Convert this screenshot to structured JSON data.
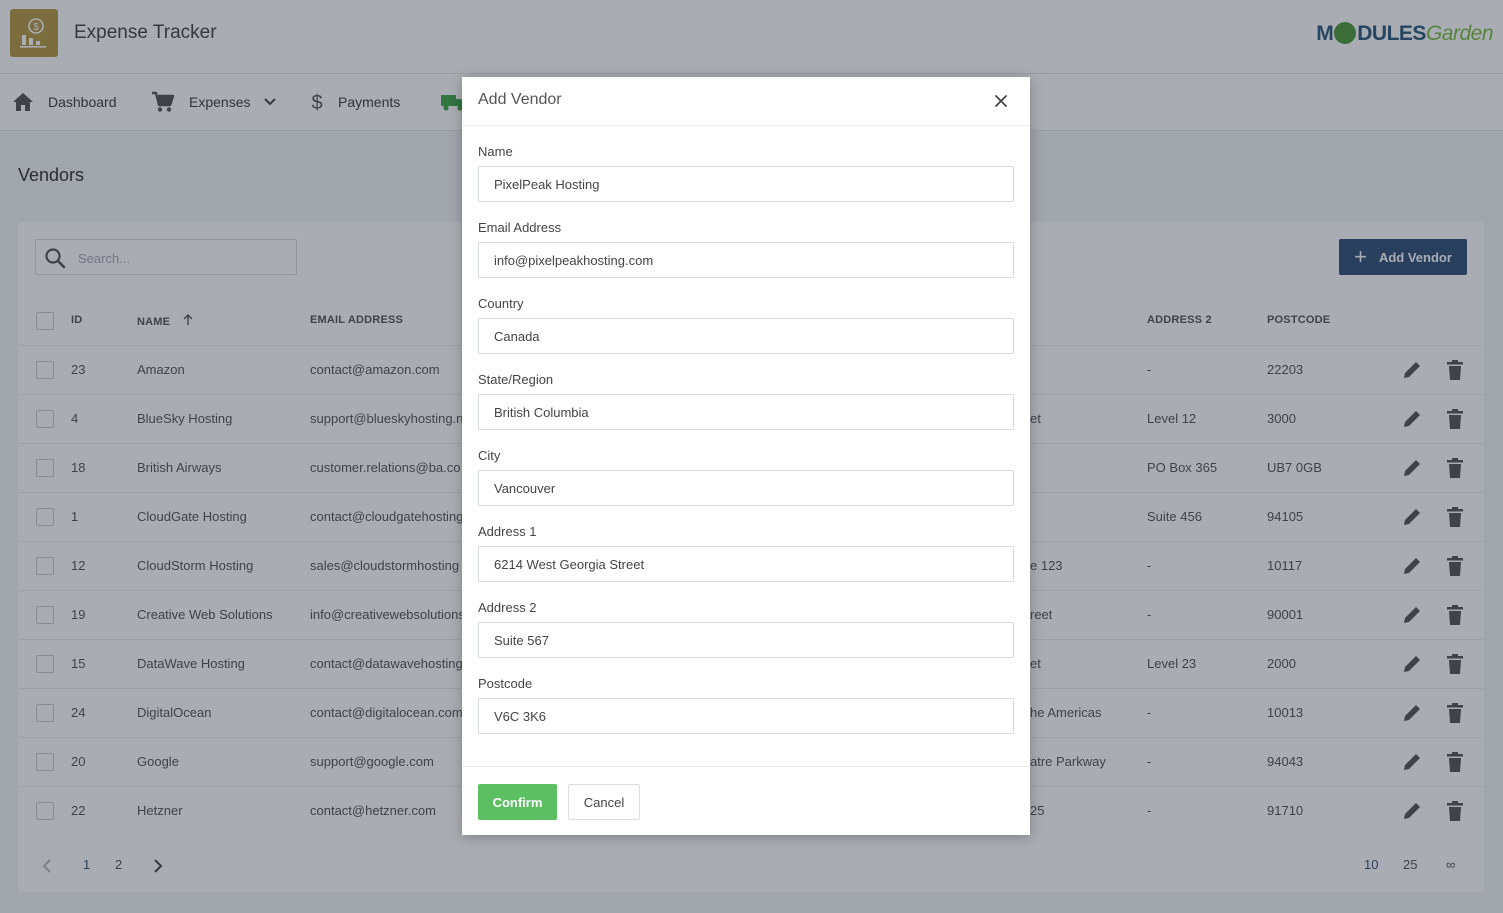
{
  "app": {
    "title": "Expense Tracker",
    "brand_main": "M",
    "brand_rest": "DULES",
    "brand_garden": "Garden"
  },
  "nav": [
    {
      "label": "Dashboard",
      "icon": "home-icon"
    },
    {
      "label": "Expenses",
      "icon": "cart-icon"
    },
    {
      "label": "Payments",
      "icon": "dollar-icon"
    },
    {
      "label": "",
      "icon": "truck-icon"
    }
  ],
  "page": {
    "title": "Vendors"
  },
  "toolbar": {
    "search_placeholder": "Search...",
    "add_label": "Add Vendor"
  },
  "table": {
    "headers": [
      "ID",
      "Name",
      "Email Address",
      "Address 2",
      "Postcode"
    ],
    "rows": [
      {
        "id": "23",
        "name": "Amazon",
        "email": "contact@amazon.com",
        "address1": "",
        "address2": "-",
        "postcode": "22203"
      },
      {
        "id": "4",
        "name": "BlueSky Hosting",
        "email": "support@blueskyhosting.n",
        "address1": "et",
        "address2": "Level 12",
        "postcode": "3000"
      },
      {
        "id": "18",
        "name": "British Airways",
        "email": "customer.relations@ba.co",
        "address1": "",
        "address2": "PO Box 365",
        "postcode": "UB7 0GB"
      },
      {
        "id": "1",
        "name": "CloudGate Hosting",
        "email": "contact@cloudgatehosting",
        "address1": "",
        "address2": "Suite 456",
        "postcode": "94105"
      },
      {
        "id": "12",
        "name": "CloudStorm Hosting",
        "email": "sales@cloudstormhosting",
        "address1": "e 123",
        "address2": "-",
        "postcode": "10117"
      },
      {
        "id": "19",
        "name": "Creative Web Solutions",
        "email": "info@creativewebsolutions",
        "address1": "reet",
        "address2": "-",
        "postcode": "90001"
      },
      {
        "id": "15",
        "name": "DataWave Hosting",
        "email": "contact@datawavehosting",
        "address1": "et",
        "address2": "Level 23",
        "postcode": "2000"
      },
      {
        "id": "24",
        "name": "DigitalOcean",
        "email": "contact@digitalocean.com",
        "address1": "he Americas",
        "address2": "-",
        "postcode": "10013"
      },
      {
        "id": "20",
        "name": "Google",
        "email": "support@google.com",
        "address1": "atre Parkway",
        "address2": "-",
        "postcode": "94043"
      },
      {
        "id": "22",
        "name": "Hetzner",
        "email": "contact@hetzner.com",
        "address1": "25",
        "address2": "-",
        "postcode": "91710"
      }
    ]
  },
  "pagination": {
    "pages": [
      "1",
      "2"
    ],
    "sizes": [
      "10",
      "25",
      "∞"
    ],
    "active_size": "10"
  },
  "modal": {
    "title": "Add Vendor",
    "fields": [
      {
        "label": "Name",
        "value": "PixelPeak Hosting"
      },
      {
        "label": "Email Address",
        "value": "info@pixelpeakhosting.com"
      },
      {
        "label": "Country",
        "value": "Canada"
      },
      {
        "label": "State/Region",
        "value": "British Columbia"
      },
      {
        "label": "City",
        "value": "Vancouver"
      },
      {
        "label": "Address 1",
        "value": "6214 West Georgia Street"
      },
      {
        "label": "Address 2",
        "value": "Suite 567"
      },
      {
        "label": "Postcode",
        "value": "V6C 3K6"
      }
    ],
    "confirm_label": "Confirm",
    "cancel_label": "Cancel"
  },
  "colors": {
    "brand": "#b59a43",
    "primary": "#2f4f78",
    "confirm": "#5cc063"
  }
}
